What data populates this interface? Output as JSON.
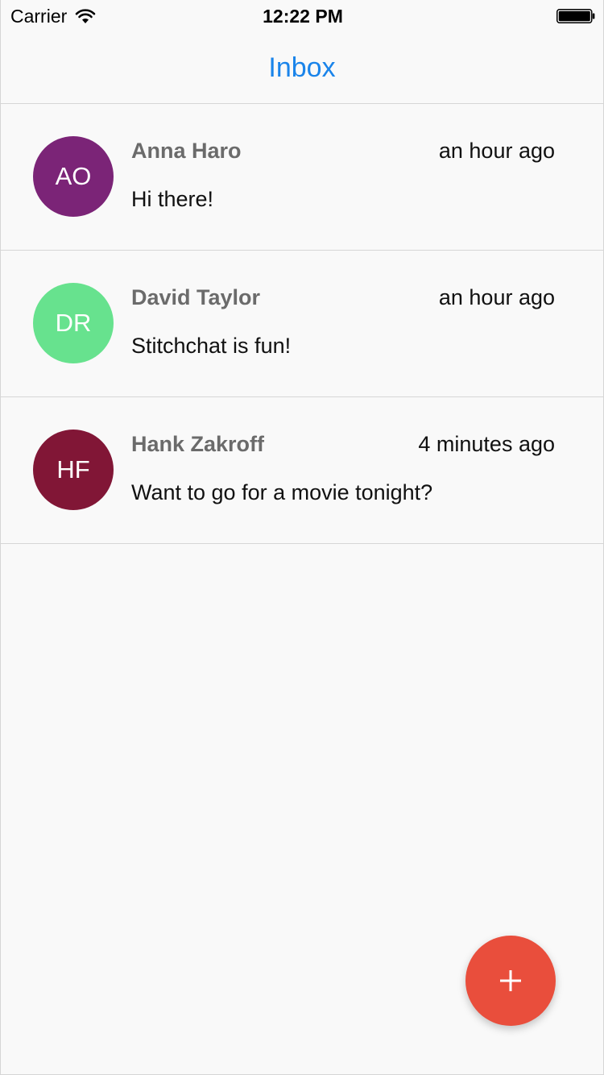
{
  "status_bar": {
    "carrier": "Carrier",
    "time": "12:22 PM",
    "wifi_icon": "wifi-icon",
    "battery_icon": "battery-full-icon"
  },
  "nav": {
    "title": "Inbox",
    "title_color": "#1a84ea"
  },
  "messages": [
    {
      "initials": "AO",
      "avatar_color": "#7b2477",
      "sender": "Anna Haro",
      "time": "an hour ago",
      "preview": "Hi there!"
    },
    {
      "initials": "DR",
      "avatar_color": "#67e28e",
      "sender": "David Taylor",
      "time": "an hour ago",
      "preview": "Stitchchat is fun!"
    },
    {
      "initials": "HF",
      "avatar_color": "#811636",
      "sender": "Hank Zakroff",
      "time": "4 minutes ago",
      "preview": "Want to go for a movie tonight?"
    }
  ],
  "fab": {
    "icon": "plus-icon",
    "color": "#e94e3c"
  }
}
